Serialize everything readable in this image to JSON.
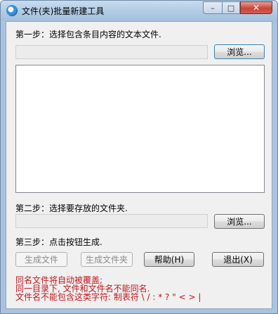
{
  "window": {
    "title": "文件(夹)批量新建工具",
    "caption": {
      "minimize": "–",
      "maximize": "□",
      "close": "✕"
    }
  },
  "step1": {
    "label": "第一步：选择包含条目内容的文本文件.",
    "path_value": "",
    "browse_label": "浏览..."
  },
  "content_list": {
    "value": ""
  },
  "step2": {
    "label": "第二步：选择要存放的文件夹.",
    "path_value": "",
    "browse_label": "浏览..."
  },
  "step3": {
    "label": "第三步：点击按钮生成."
  },
  "buttons": {
    "generate_files": "生成文件",
    "generate_folders": "生成文件夹",
    "help": "帮助(H)",
    "exit": "退出(X)"
  },
  "notes": {
    "line1": "同名文件将自动被覆盖;",
    "line2": "同一目录下, 文件和文件名不能同名.",
    "line3": "文件名不能包含这类字符: 制表符  \\ / : * ? \" < > |"
  },
  "colors": {
    "warning_text": "#c0161c",
    "window_frame": "#a9c3df",
    "close_button": "#c7453a"
  }
}
